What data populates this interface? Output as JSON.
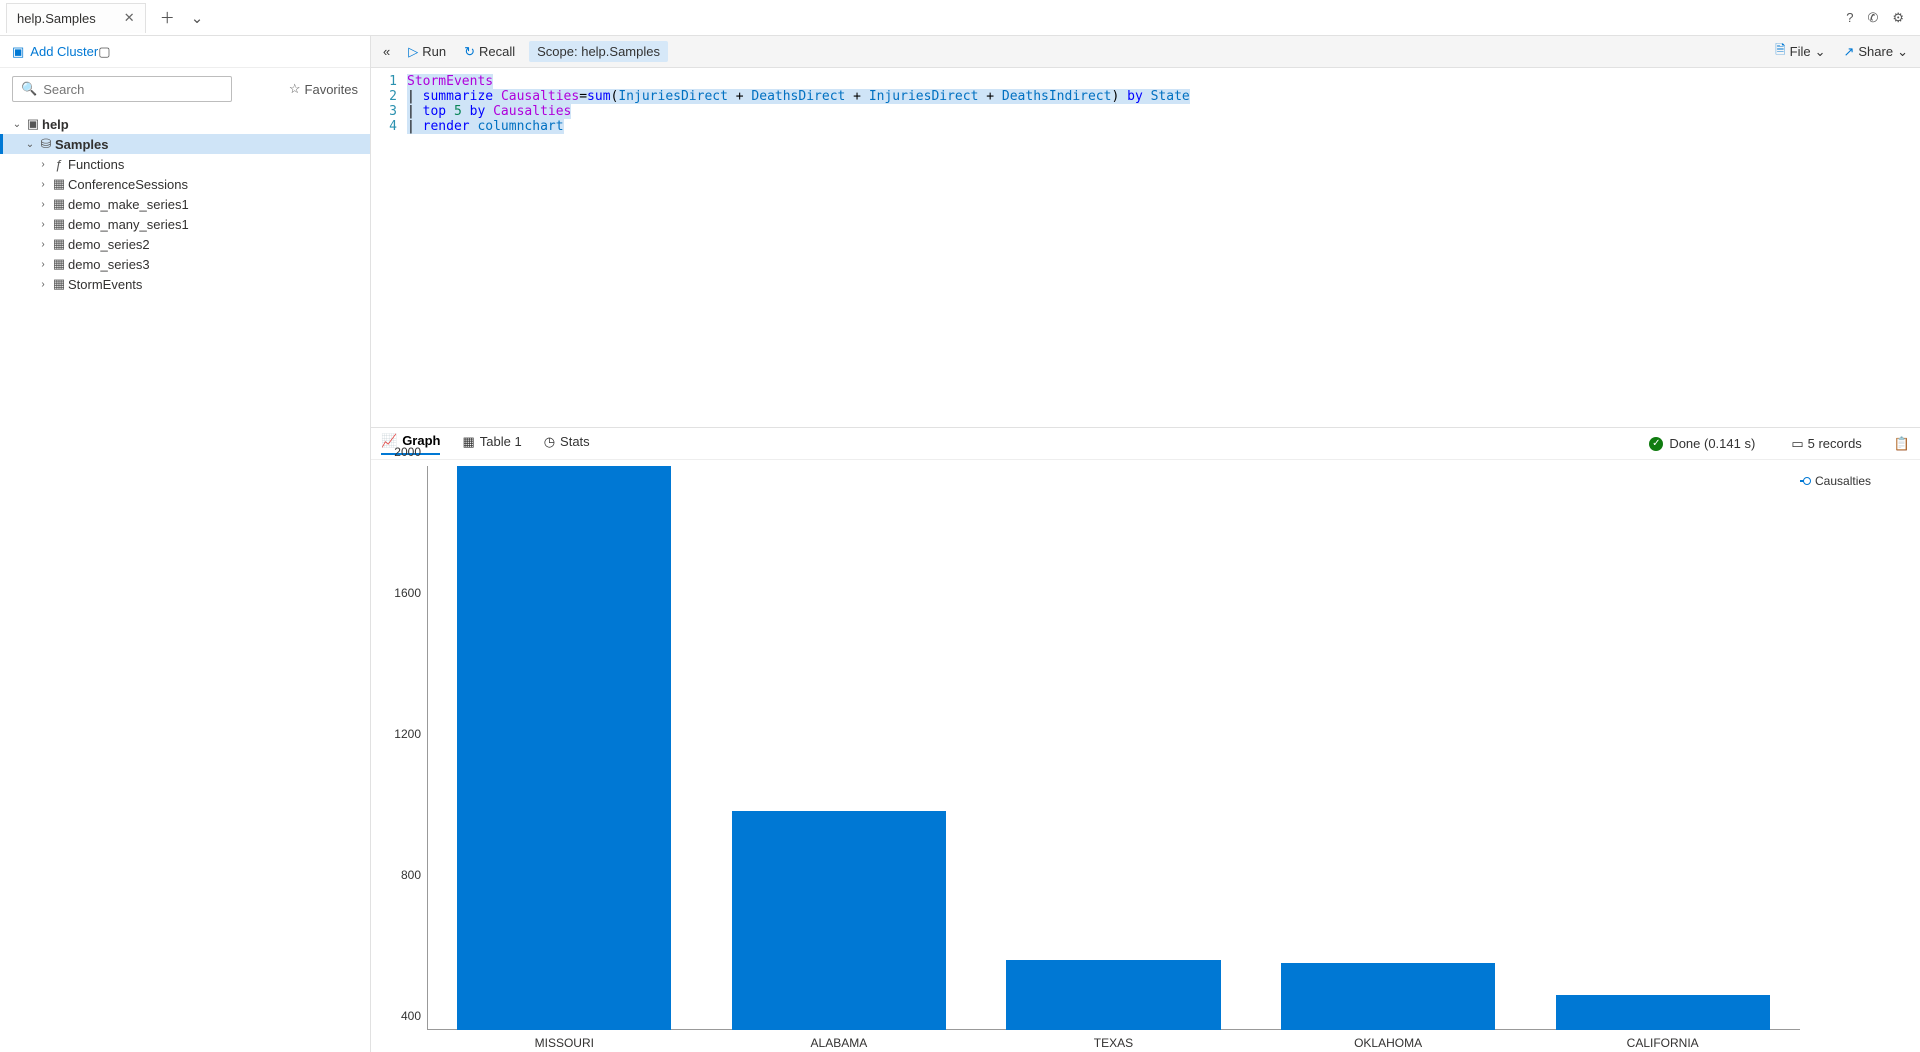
{
  "tab": {
    "title": "help.Samples"
  },
  "topbar": {
    "add_cluster": "Add Cluster",
    "search_placeholder": "Search",
    "favorites": "Favorites"
  },
  "tree": {
    "root": {
      "label": "help"
    },
    "db": {
      "label": "Samples"
    },
    "items": [
      {
        "label": "Functions",
        "kind": "fn"
      },
      {
        "label": "ConferenceSessions",
        "kind": "tbl"
      },
      {
        "label": "demo_make_series1",
        "kind": "tbl"
      },
      {
        "label": "demo_many_series1",
        "kind": "tbl"
      },
      {
        "label": "demo_series2",
        "kind": "tbl"
      },
      {
        "label": "demo_series3",
        "kind": "tbl"
      },
      {
        "label": "StormEvents",
        "kind": "tbl"
      }
    ]
  },
  "toolbar": {
    "run": "Run",
    "recall": "Recall",
    "scope": "Scope: help.Samples",
    "file": "File",
    "share": "Share"
  },
  "editor": {
    "lines": [
      "StormEvents",
      "| summarize Causalties=sum(InjuriesDirect + DeathsDirect + InjuriesDirect + DeathsIndirect) by State",
      "| top 5 by Causalties",
      "| render columnchart"
    ]
  },
  "result_tabs": {
    "graph": "Graph",
    "table": "Table 1",
    "stats": "Stats"
  },
  "status": {
    "done": "Done (0.141 s)",
    "records": "5 records"
  },
  "legend": {
    "series": "Causalties"
  },
  "chart_data": {
    "type": "bar",
    "categories": [
      "MISSOURI",
      "ALABAMA",
      "TEXAS",
      "OKLAHOMA",
      "CALIFORNIA"
    ],
    "values": [
      2000,
      1020,
      600,
      590,
      500
    ],
    "xlabel": "",
    "ylabel": "",
    "ylim": [
      400,
      2000
    ],
    "yticks": [
      400,
      800,
      1200,
      1600,
      2000
    ]
  }
}
